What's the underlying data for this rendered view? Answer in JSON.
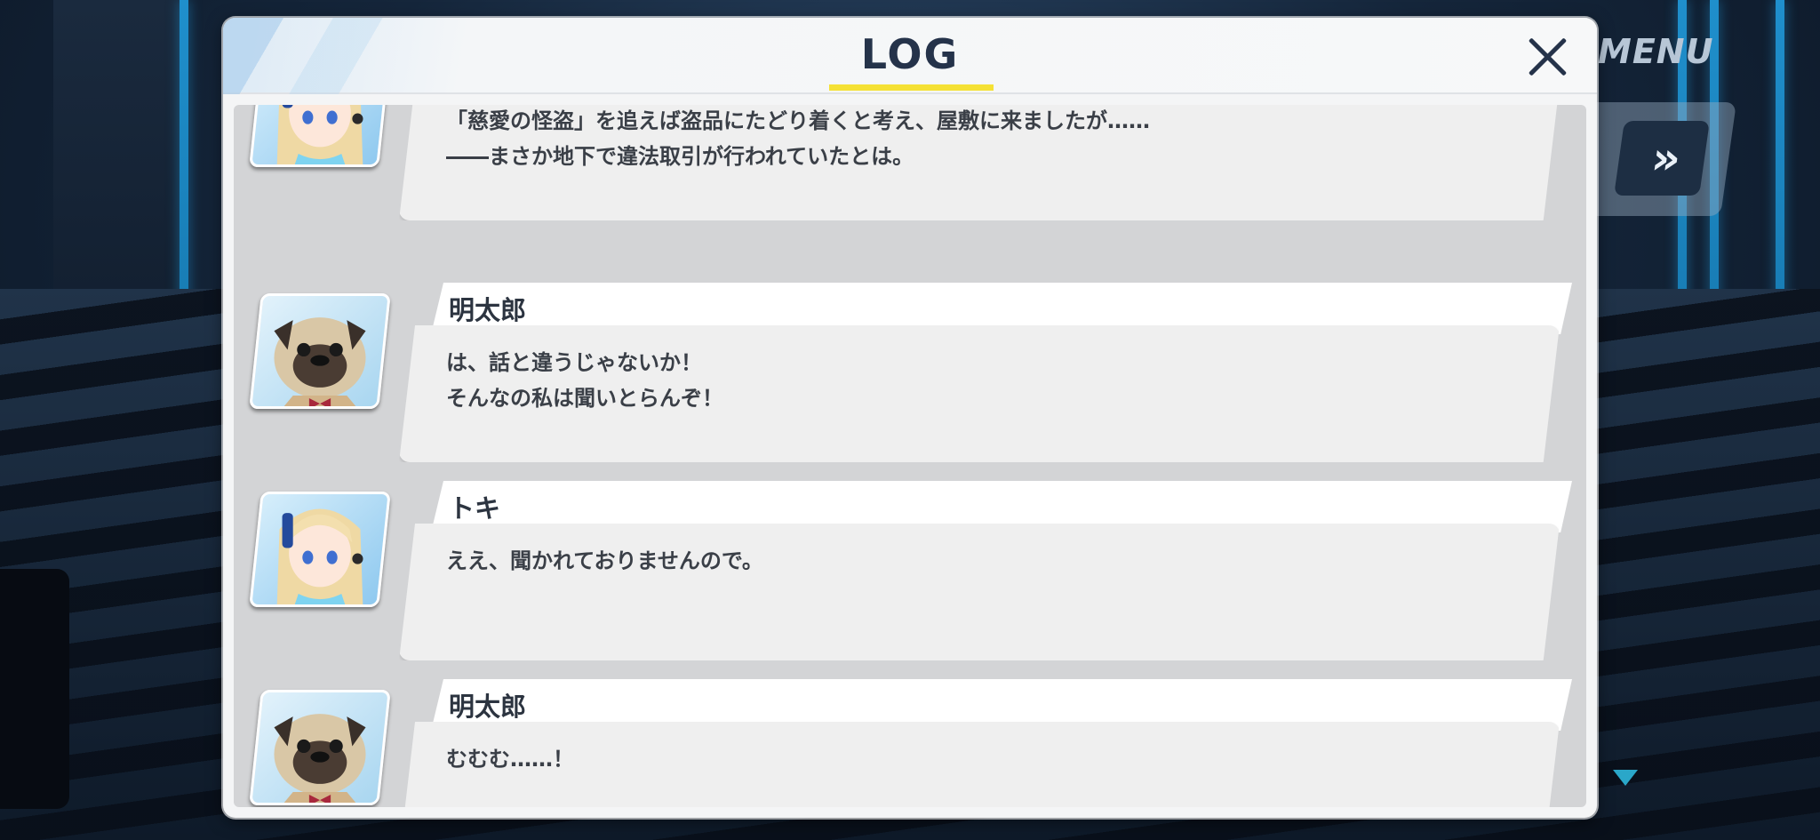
{
  "screen": {
    "menu_label": "MENU",
    "fast_forward_glyph": "»"
  },
  "log": {
    "title": "LOG",
    "close_glyph": "close-icon",
    "accent_color": "#f5e135",
    "entries": [
      {
        "speaker": "",
        "avatar": "toki-portrait",
        "text": "「慈愛の怪盗」を追えば盗品にたどり着くと考え、屋敷に来ましたが……\n――まさか地下で違法取引が行われていたとは。"
      },
      {
        "speaker": "明太郎",
        "avatar": "pug-portrait",
        "text": "は、話と違うじゃないか！\nそんなの私は聞いとらんぞ！"
      },
      {
        "speaker": "トキ",
        "avatar": "toki-portrait",
        "text": "ええ、聞かれておりませんので。"
      },
      {
        "speaker": "明太郎",
        "avatar": "pug-portrait",
        "text": "むむむ……！"
      }
    ]
  }
}
